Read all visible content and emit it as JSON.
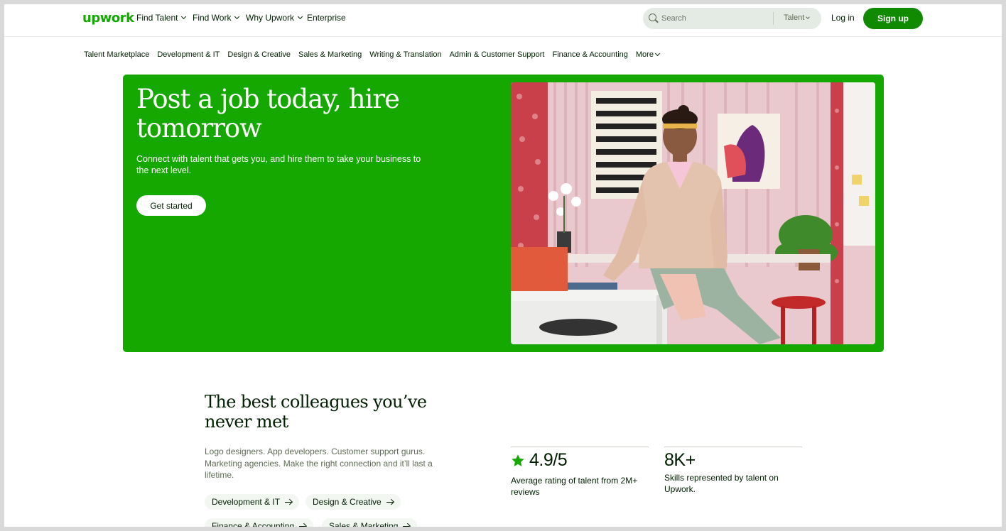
{
  "brand": {
    "logo_text": "upwork",
    "accent": "#14a800",
    "button_green": "#108a00"
  },
  "topnav": {
    "items": [
      {
        "label": "Find Talent",
        "has_dropdown": true
      },
      {
        "label": "Find Work",
        "has_dropdown": true
      },
      {
        "label": "Why Upwork",
        "has_dropdown": true
      },
      {
        "label": "Enterprise",
        "has_dropdown": false
      }
    ],
    "search": {
      "placeholder": "Search",
      "scope": "Talent"
    },
    "login_label": "Log in",
    "signup_label": "Sign up"
  },
  "categories": [
    "Talent Marketplace",
    "Development & IT",
    "Design & Creative",
    "Sales & Marketing",
    "Writing & Translation",
    "Admin & Customer Support",
    "Finance & Accounting",
    "More"
  ],
  "hero": {
    "title": "Post a job today, hire tomorrow",
    "subtitle": "Connect with talent that gets you, and hire them to take your business to the next level.",
    "cta_label": "Get started"
  },
  "colleagues": {
    "title": "The best colleagues you’ve never met",
    "description": "Logo designers. App developers. Customer support gurus. Marketing agencies. Make the right connection and it’ll last a lifetime.",
    "pills": [
      "Development & IT",
      "Design & Creative",
      "Finance & Accounting",
      "Sales & Marketing"
    ]
  },
  "stats": [
    {
      "value": "4.9/5",
      "description": "Average rating of talent from 2M+ reviews",
      "icon": "star-icon"
    },
    {
      "value": "8K+",
      "description": "Skills represented by talent on Upwork."
    }
  ]
}
